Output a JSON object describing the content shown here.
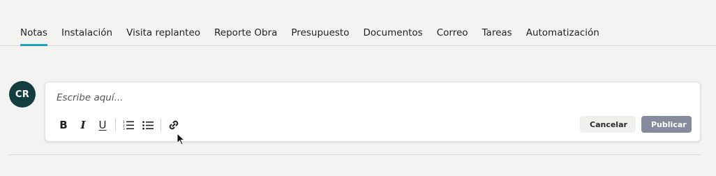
{
  "tabs": [
    {
      "label": "Notas",
      "active": true
    },
    {
      "label": "Instalación",
      "active": false
    },
    {
      "label": "Visita replanteo",
      "active": false
    },
    {
      "label": "Reporte Obra",
      "active": false
    },
    {
      "label": "Presupuesto",
      "active": false
    },
    {
      "label": "Documentos",
      "active": false
    },
    {
      "label": "Correo",
      "active": false
    },
    {
      "label": "Tareas",
      "active": false
    },
    {
      "label": "Automatización",
      "active": false
    }
  ],
  "avatar": {
    "initials": "CR"
  },
  "editor": {
    "placeholder": "Escribe aquí...",
    "value": "",
    "toolbar": {
      "bold": "B",
      "italic": "I",
      "underline": "U",
      "icons": [
        "ordered-list-icon",
        "bullet-list-icon",
        "link-icon"
      ]
    }
  },
  "actions": {
    "cancel_label": "Cancelar",
    "publish_label": "Publicar"
  },
  "colors": {
    "background": "#f3f3f2",
    "active_tab_underline": "#1aa3bf",
    "avatar_bg": "#143d3f",
    "publish_bg": "#858b9c",
    "cancel_bg": "#f0f0ef"
  }
}
